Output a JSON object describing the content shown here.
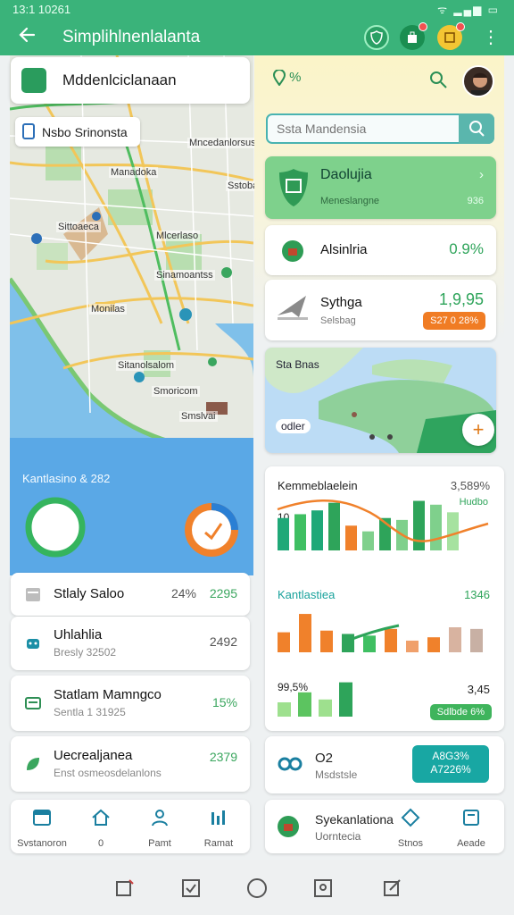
{
  "status": {
    "time": "13:1 10261",
    "icons": "ᯤ ▂▄▆ ▭"
  },
  "appbar": {
    "title": "Simplihlnenlalanta"
  },
  "map": {
    "title": "Mddenlciclanaan",
    "search_label": "Nsbo Srinonsta",
    "labels": [
      "Mncedanlorsus",
      "Manadoka",
      "Sstobat",
      "Mlcerlaso",
      "Sinamoantss",
      "Sitanolsalom",
      "Smslvai",
      "Sittoaeca",
      "Monilas",
      "Smoricom"
    ],
    "donut_caption": "Kantlasino & 282"
  },
  "left_cards": [
    {
      "title": "Stlaly Saloo",
      "value": "24%",
      "value2": "2295",
      "icon": "calendar-icon"
    },
    {
      "title": "Uhlahlia",
      "sub": "Bresly 32502",
      "value": "2492",
      "icon": "robot-icon"
    },
    {
      "title": "Statlam Mamngco",
      "sub": "Sentla 1 31925",
      "value": "15%",
      "icon": "card-icon"
    },
    {
      "title": "Uecrealjanea",
      "sub": "Enst osmeosdelanlons",
      "value": "2379",
      "icon": "leaf-icon"
    }
  ],
  "left_nav": [
    {
      "label": "Svstanoron",
      "icon": "window-icon"
    },
    {
      "label": "0",
      "icon": "house-icon"
    },
    {
      "label": "Pamt",
      "icon": "person-icon"
    },
    {
      "label": "Ramat",
      "icon": "chart-icon"
    }
  ],
  "right": {
    "pin_text": "%",
    "search": {
      "placeholder": "Ssta Mandensia"
    },
    "dash": {
      "title": "Daolujia",
      "sub": "Meneslangne",
      "value": "936"
    },
    "card_a": {
      "title": "Alsinlria",
      "value": "0.9%"
    },
    "card_s": {
      "title": "Sythga",
      "sub": "Selsbag",
      "value": "1,9,95",
      "pill": "S27 0 28%"
    },
    "mini_map": {
      "label_top": "Sta Bnas",
      "label_bottom": "odler"
    },
    "chart": {
      "title": "Kemmeblaelein",
      "value": "3,589%",
      "legend": "Hudbo",
      "axis_label": "10",
      "section2_title": "Kantlastiea",
      "section2_value": "1346",
      "section3_value": "99,5%",
      "section3_right": "3,45",
      "section3_pill": "Sdlbde 6%"
    },
    "o2": {
      "title": "O2",
      "sub": "Msdstsle",
      "pill_line1": "A8G3%",
      "pill_line2": "A7226%"
    },
    "nav": {
      "title": "Syekanlationa",
      "sub": "Uorntecia",
      "item2": "Stnos",
      "item3": "Aeade"
    }
  },
  "chart_data": [
    {
      "type": "bar",
      "series": [
        {
          "name": "Hudbo",
          "values": [
            34,
            38,
            42,
            50,
            26,
            20,
            34,
            32,
            52,
            48,
            40
          ]
        }
      ],
      "categories": [
        "1",
        "2",
        "3",
        "4",
        "5",
        "6",
        "7",
        "8",
        "9",
        "10",
        "11"
      ],
      "ylim": [
        0,
        60
      ]
    },
    {
      "type": "bar",
      "values": [
        24,
        46,
        26,
        22,
        20,
        28,
        14,
        18,
        30,
        28
      ],
      "categories": [
        "1",
        "2",
        "3",
        "4",
        "5",
        "6",
        "7",
        "8",
        "9",
        "10"
      ],
      "ylim": [
        0,
        60
      ]
    },
    {
      "type": "bar",
      "values": [
        20,
        34,
        24,
        48
      ],
      "categories": [
        "1",
        "2",
        "3",
        "4"
      ],
      "ylim": [
        0,
        60
      ]
    }
  ],
  "colors": {
    "brand_green": "#3ab37a",
    "teal": "#18a7a3",
    "orange": "#f0812b",
    "sky": "#5aa8e6"
  }
}
